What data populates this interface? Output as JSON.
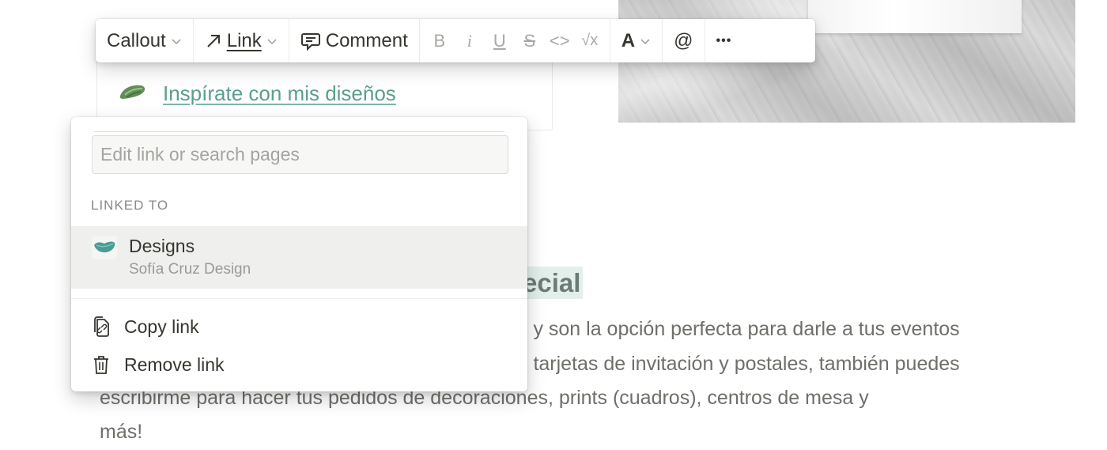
{
  "toolbar": {
    "block_type": "Callout",
    "link_label": "Link",
    "comment_label": "Comment",
    "format": {
      "bold": "B",
      "italic": "i",
      "underline": "U",
      "strike": "S",
      "code": "<>",
      "math": "√x"
    },
    "text_color_label": "A",
    "mention_label": "@",
    "more_label": "•••"
  },
  "callout": {
    "link_text": "Inspírate con mis diseños",
    "link_color": "#5a9e8c"
  },
  "heading": {
    "visible_fragment": "ecial",
    "highlight_color": "#e4efec"
  },
  "paragraph": {
    "lines": [
      "s y son la opción perfecta para darle a tus eventos",
      "s tarjetas de invitación y postales, también puedes",
      "escribirme para hacer tus pedidos de decoraciones, prints (cuadros), centros de mesa y",
      "más!"
    ]
  },
  "link_popup": {
    "search_placeholder": "Edit link or search pages",
    "search_value": "",
    "linked_section_label": "LINKED TO",
    "linked_page": {
      "title": "Designs",
      "subtitle": "Sofía Cruz Design",
      "icon": "teal-brush-icon"
    },
    "actions": [
      {
        "label": "Copy link",
        "icon": "copy-link-icon"
      },
      {
        "label": "Remove link",
        "icon": "trash-icon"
      }
    ]
  },
  "colors": {
    "accent_teal": "#5a9e8c",
    "text_primary": "#37352f",
    "text_muted": "#9b9a96",
    "hover_bg": "#efefee"
  }
}
